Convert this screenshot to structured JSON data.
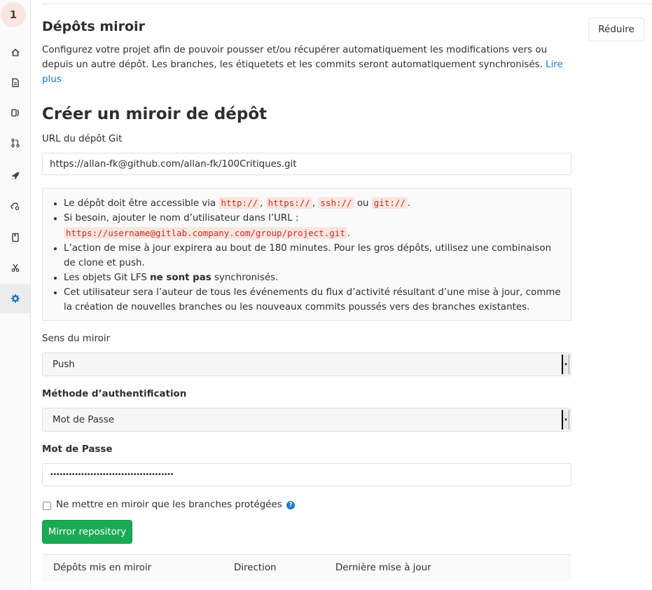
{
  "sidebar": {
    "avatar_letter": "1",
    "items": [
      {
        "icon": "home-icon"
      },
      {
        "icon": "file-icon"
      },
      {
        "icon": "issues-icon"
      },
      {
        "icon": "merge-request-icon"
      },
      {
        "icon": "rocket-icon"
      },
      {
        "icon": "cloud-gear-icon"
      },
      {
        "icon": "book-icon"
      },
      {
        "icon": "scissors-icon"
      },
      {
        "icon": "settings-icon"
      }
    ]
  },
  "section": {
    "title": "Dépôts miroir",
    "collapse_label": "Réduire",
    "description": "Configurez votre projet afin de pouvoir pousser et/ou récupérer automatiquement les modifications vers ou depuis un autre dépôt. Les branches, les étiquetets et les commits seront automatiquement synchronisés.",
    "learn_more": "Lire plus"
  },
  "form": {
    "title": "Créer un miroir de dépôt",
    "url_label": "URL du dépôt Git",
    "url_value": "https://allan-fk@github.com/allan-fk/100Critiques.git",
    "info": {
      "b1_pre": "Le dépôt doit être accessible via",
      "b1_c1": "http://",
      "b1_c2": "https://",
      "b1_c3": "ssh://",
      "b1_or": "ou",
      "b1_c4": "git://",
      "b2_pre": "Si besoin, ajouter le nom d’utilisateur dans l’URL :",
      "b2_code": "https://username@gitlab.company.com/group/project.git",
      "b3": "L’action de mise à jour expirera au bout de 180 minutes. Pour les gros dépôts, utilisez une combinaison de clone et push.",
      "b4_pre": "Les objets Git LFS",
      "b4_bold": "ne sont pas",
      "b4_post": "synchronisés.",
      "b5": "Cet utilisateur sera l’auteur de tous les événements du flux d’activité résultant d’une mise à jour, comme la création de nouvelles branches ou les nouveaux commits poussés vers des branches existantes."
    },
    "direction_label": "Sens du miroir",
    "direction_value": "Push",
    "auth_label": "Méthode d’authentification",
    "auth_value": "Mot de Passe",
    "password_label": "Mot de Passe",
    "password_value": "••••••••••••••••••••••••••••••••••••••••",
    "protected_label": "Ne mettre en miroir que les branches protégées",
    "submit_label": "Mirror repository"
  },
  "table": {
    "headers": [
      "Dépôts mis en miroir",
      "Direction",
      "Dernière mise à jour"
    ]
  },
  "colors": {
    "accent": "#1f78d1",
    "success": "#1aaa55",
    "code_text": "#c0341d",
    "code_bg": "#fbe5e1"
  }
}
